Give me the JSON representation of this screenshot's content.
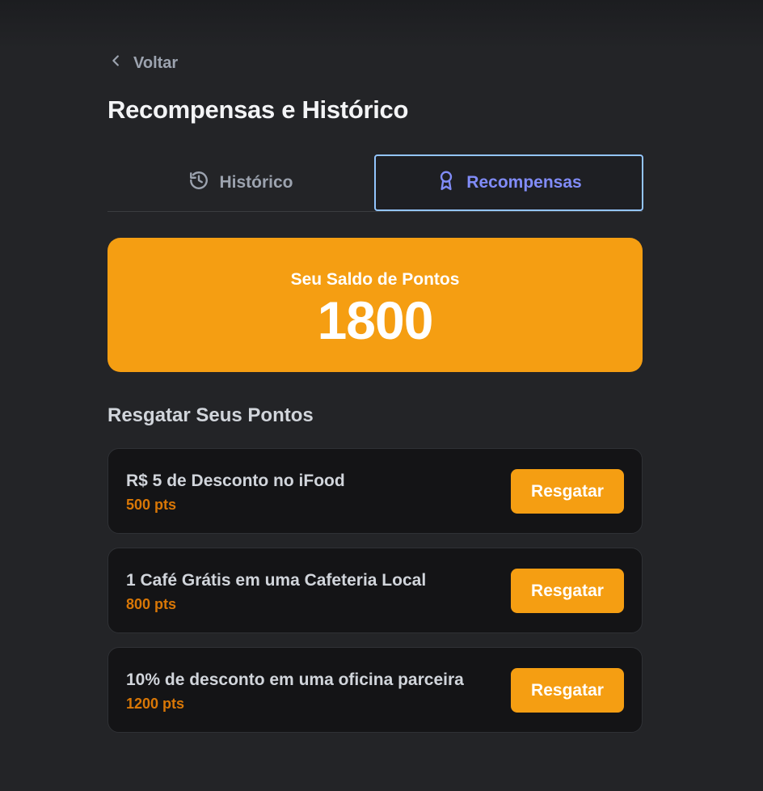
{
  "nav": {
    "back_label": "Voltar",
    "back_icon": "chevron-left-icon"
  },
  "page": {
    "title": "Recompensas e Histórico"
  },
  "tabs": [
    {
      "label": "Histórico",
      "icon": "history-icon",
      "active": false
    },
    {
      "label": "Recompensas",
      "icon": "award-icon",
      "active": true
    }
  ],
  "balance": {
    "label": "Seu Saldo de Pontos",
    "value": "1800"
  },
  "redeem_section": {
    "title": "Resgatar Seus Pontos",
    "items": [
      {
        "name": "R$ 5 de Desconto no iFood",
        "cost": "500 pts",
        "button_label": "Resgatar"
      },
      {
        "name": "1 Café Grátis em uma Cafeteria Local",
        "cost": "800 pts",
        "button_label": "Resgatar"
      },
      {
        "name": "10% de desconto em uma oficina parceira",
        "cost": "1200 pts",
        "button_label": "Resgatar"
      }
    ]
  },
  "colors": {
    "accent_orange": "#f59e12",
    "cost_orange": "#d97706",
    "active_tab_text": "#818cf8",
    "active_tab_border": "#93c5fd",
    "background": "#232427",
    "card_background": "#141416"
  }
}
